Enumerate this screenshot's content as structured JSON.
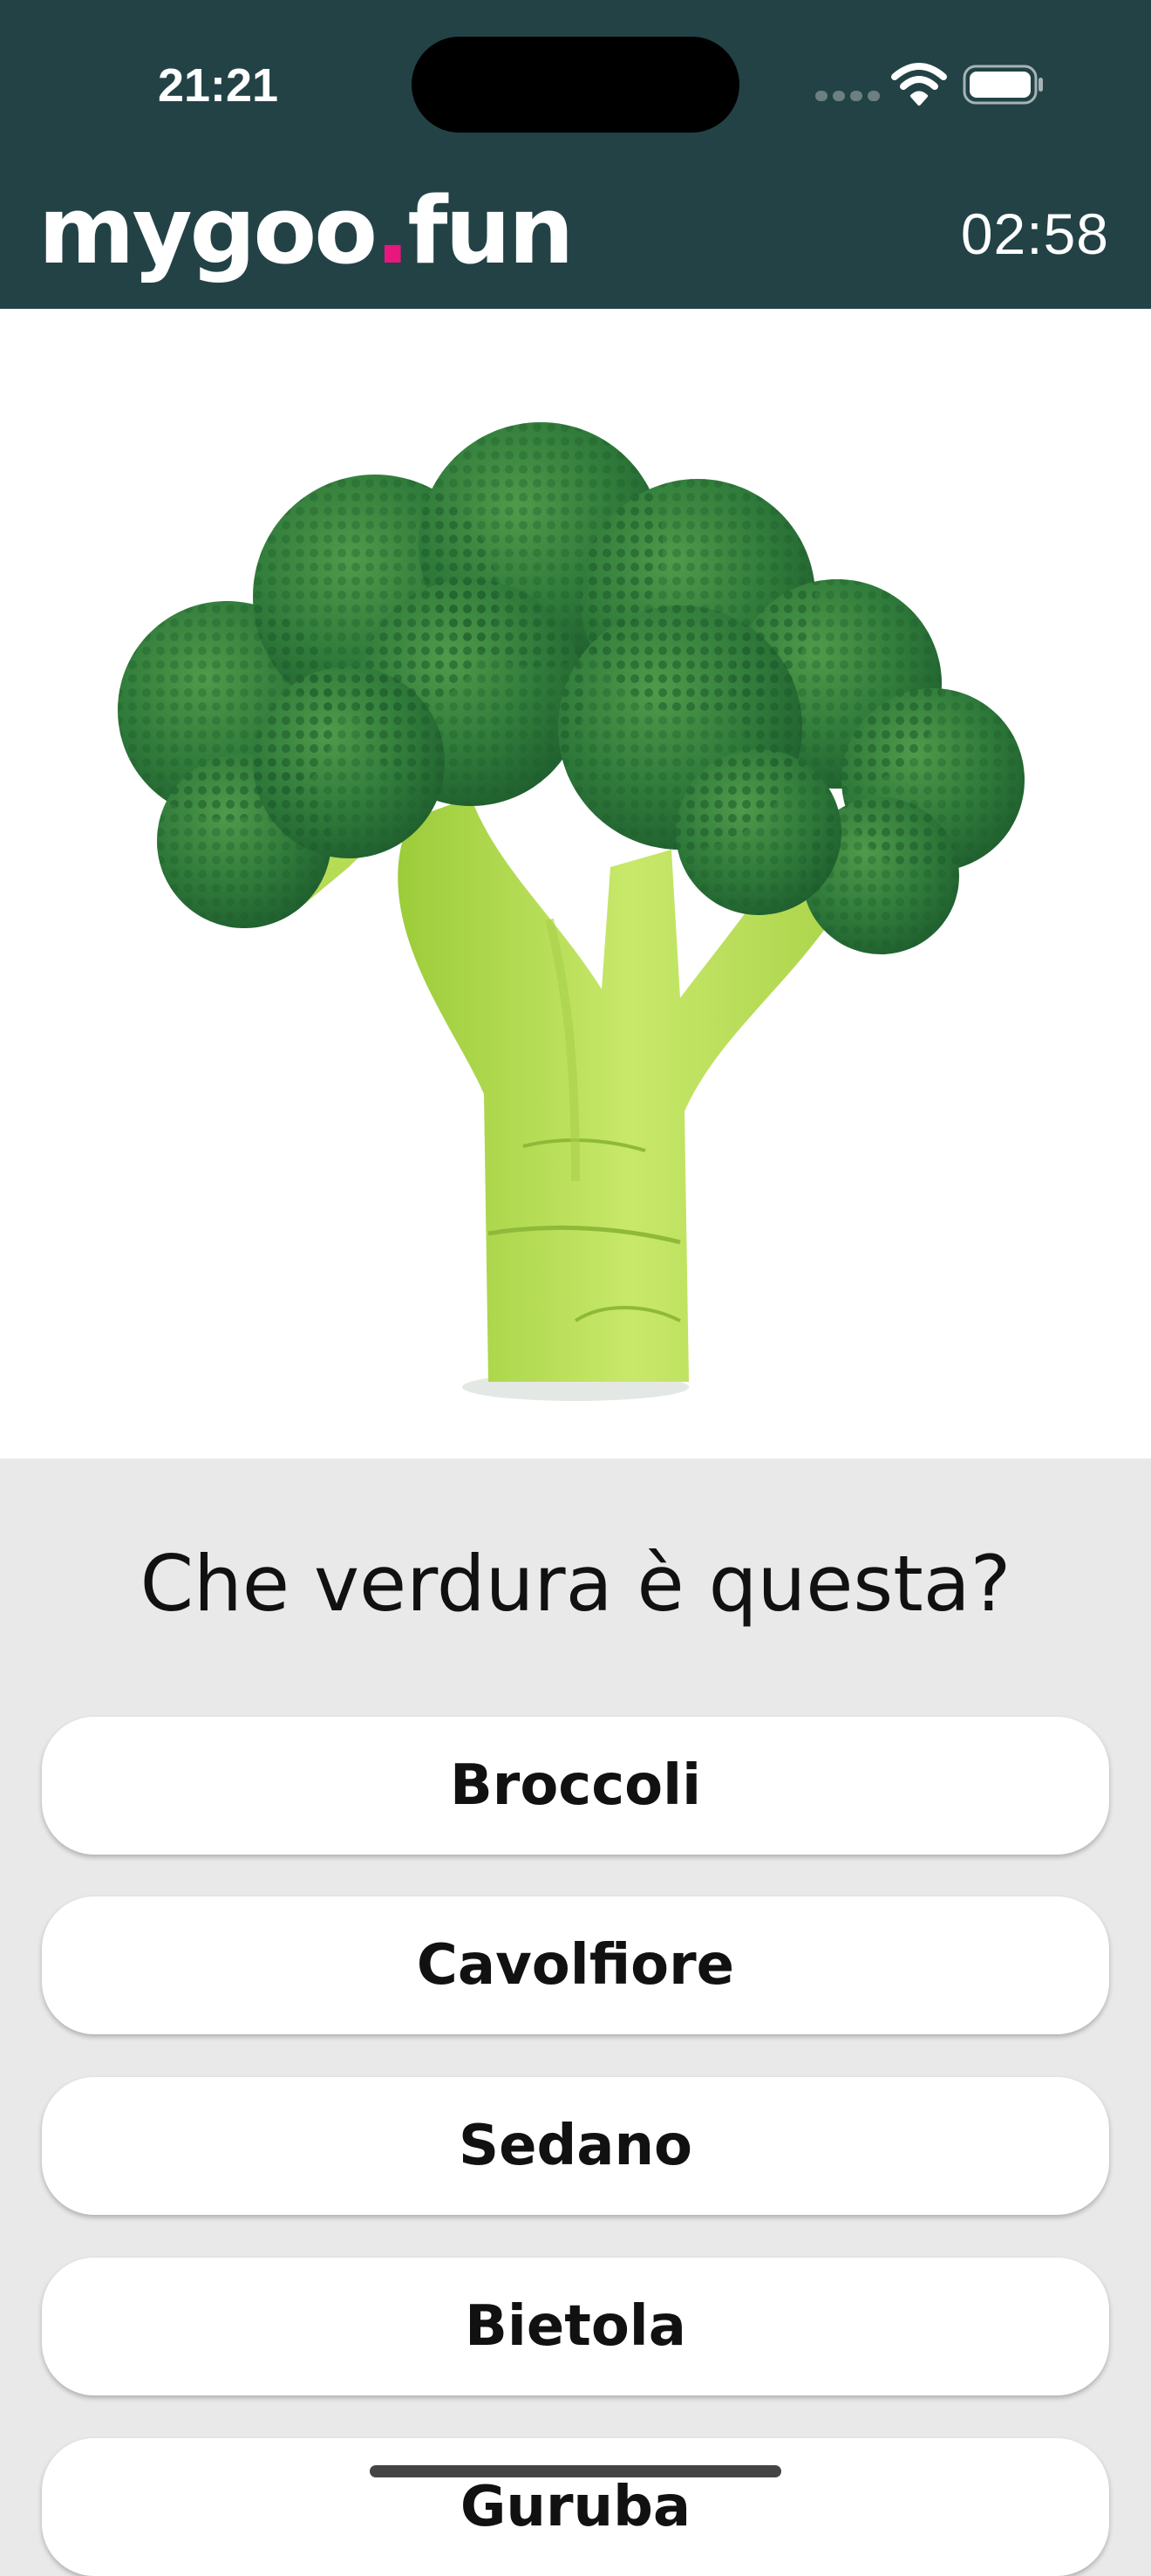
{
  "status_bar": {
    "time": "21:21"
  },
  "header": {
    "logo_main": "mygoo",
    "logo_dot": ".",
    "logo_tld": "fun",
    "timer": "02:58"
  },
  "image": {
    "icon": "broccoli-image"
  },
  "quiz": {
    "question": "Che verdura è questa?",
    "answers": [
      "Broccoli",
      "Cavolfiore",
      "Sedano",
      "Bietola",
      "Guruba"
    ]
  },
  "colors": {
    "header_bg": "#224246",
    "logo_dot": "#e8177f",
    "page_bg": "#e9e9e9",
    "button_bg": "#ffffff"
  }
}
